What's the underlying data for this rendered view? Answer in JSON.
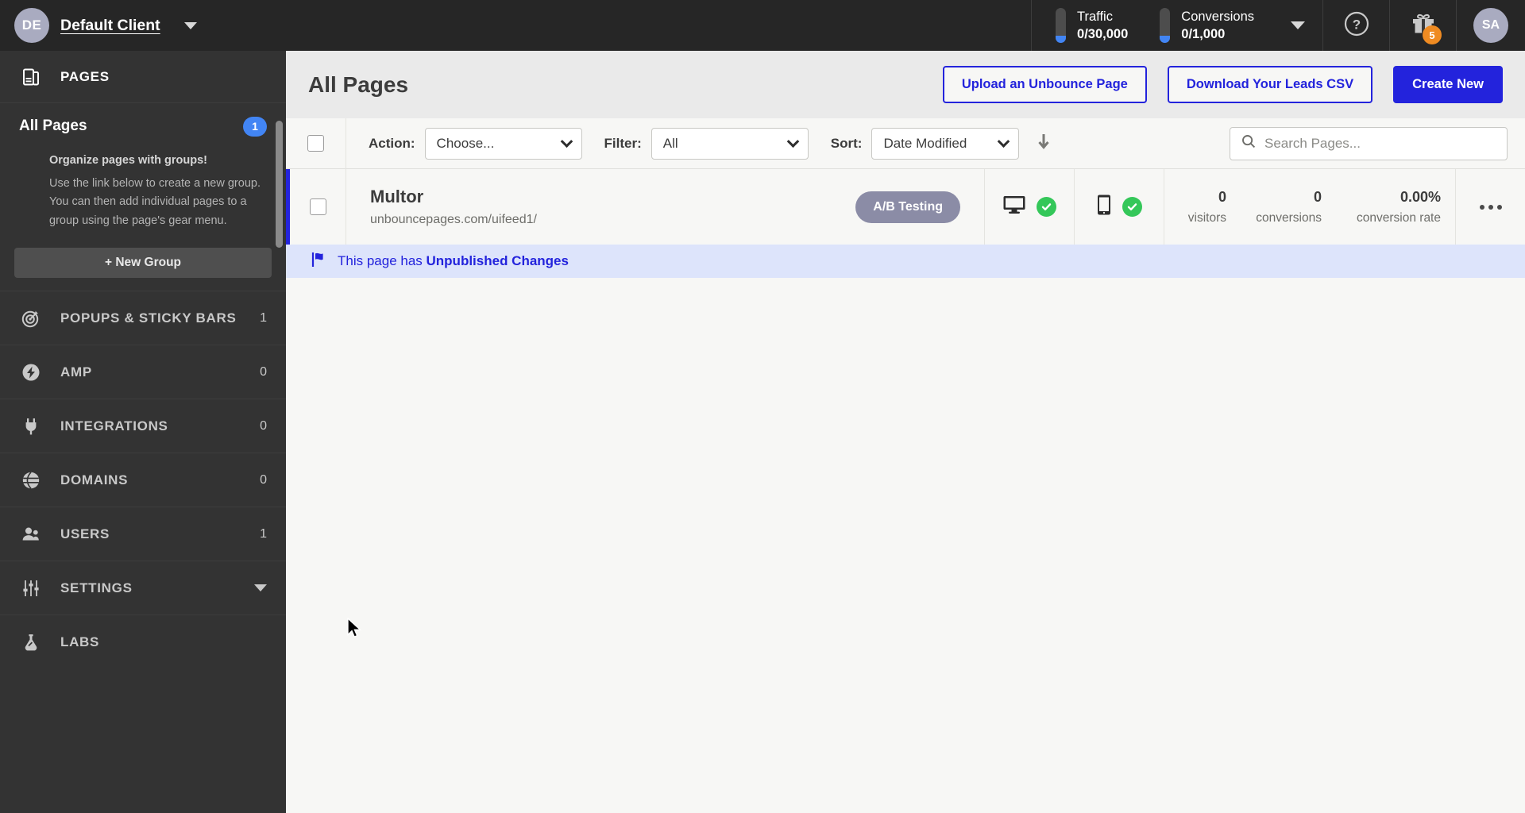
{
  "sidebar": {
    "client": {
      "initials": "DE",
      "name": "Default Client"
    },
    "section": {
      "label": "PAGES",
      "icon": "pages-icon"
    },
    "all_pages": {
      "label": "All Pages",
      "count": "1"
    },
    "promo": {
      "title": "Organize pages with groups!",
      "body": "Use the link below to create a new group. You can then add individual pages to a group using the page's gear menu."
    },
    "new_group_label": "+ New Group",
    "items": [
      {
        "label": "POPUPS & STICKY BARS",
        "count": "1",
        "icon": "target-icon"
      },
      {
        "label": "AMP",
        "count": "0",
        "icon": "bolt-icon"
      },
      {
        "label": "INTEGRATIONS",
        "count": "0",
        "icon": "plug-icon"
      },
      {
        "label": "DOMAINS",
        "count": "0",
        "icon": "globe-icon"
      },
      {
        "label": "USERS",
        "count": "1",
        "icon": "users-icon"
      },
      {
        "label": "SETTINGS",
        "count": "",
        "icon": "sliders-icon"
      },
      {
        "label": "LABS",
        "count": "",
        "icon": "flask-icon"
      }
    ]
  },
  "topbar": {
    "meters": [
      {
        "label": "Traffic",
        "value": "0/30,000"
      },
      {
        "label": "Conversions",
        "value": "0/1,000"
      }
    ],
    "help_icon": "help-circle-icon",
    "gift_icon": "gift-icon",
    "gift_badge": "5",
    "user_initials": "SA"
  },
  "page_header": {
    "title": "All Pages",
    "upload_label": "Upload an Unbounce Page",
    "download_label": "Download Your Leads CSV",
    "create_label": "Create New"
  },
  "toolbar": {
    "action_label": "Action:",
    "action_value": "Choose...",
    "filter_label": "Filter:",
    "filter_value": "All",
    "sort_label": "Sort:",
    "sort_value": "Date Modified",
    "sort_direction_icon": "arrow-down-icon",
    "search_placeholder": "Search Pages..."
  },
  "page_row": {
    "title": "Multor",
    "url": "unbouncepages.com/uifeed1/",
    "badge": "A/B Testing",
    "desktop_icon": "monitor-icon",
    "mobile_icon": "mobile-icon",
    "desktop_status": "published",
    "mobile_status": "published",
    "stats": [
      {
        "value": "0",
        "label": "visitors"
      },
      {
        "value": "0",
        "label": "conversions"
      },
      {
        "value": "0.00%",
        "label": "conversion rate"
      }
    ],
    "menu_icon": "more-horizontal-icon"
  },
  "notice": {
    "icon": "flag-icon",
    "prefix": "This page has ",
    "bold": "Unpublished Changes"
  },
  "colors": {
    "accent_blue": "#2323dc",
    "badge_blue": "#4285f4",
    "success_green": "#34c759",
    "gift_orange": "#ef8b22",
    "pill_purple": "#8b8ca6",
    "notice_bg": "#dde4fb"
  }
}
